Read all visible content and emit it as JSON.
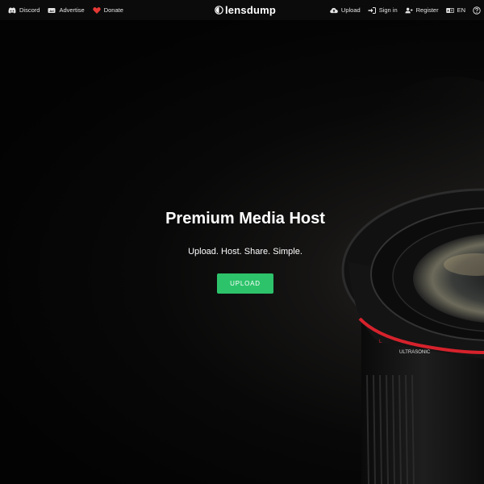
{
  "nav_left": [
    {
      "label": "Discord",
      "icon": "discord-icon"
    },
    {
      "label": "Advertise",
      "icon": "ad-icon"
    },
    {
      "label": "Donate",
      "icon": "heart-icon"
    }
  ],
  "logo": {
    "text": "lensdump"
  },
  "nav_right": [
    {
      "label": "Upload",
      "icon": "cloud-upload-icon"
    },
    {
      "label": "Sign in",
      "icon": "sign-in-icon"
    },
    {
      "label": "Register",
      "icon": "user-plus-icon"
    },
    {
      "label": "EN",
      "icon": "language-icon"
    }
  ],
  "hero": {
    "title": "Premium Media Host",
    "subtitle": "Upload. Host. Share. Simple.",
    "button_label": "UPLOAD"
  },
  "colors": {
    "accent": "#2dc36a",
    "heart": "#e53935",
    "lens_ring": "#d6222c"
  }
}
